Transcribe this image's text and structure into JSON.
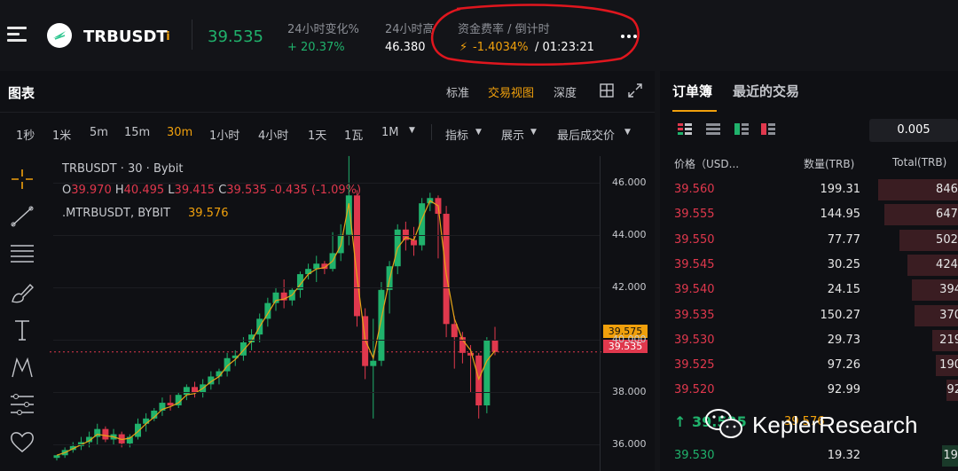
{
  "header": {
    "symbol": "TRBUSDT",
    "info_glyph": "i",
    "last_price": "39.535",
    "change_label": "24小时变化%",
    "change_value": "+ 20.37%",
    "high_label": "24小时高",
    "high_value": "46.380",
    "funding_label": "资金费率 / 倒计时",
    "funding_icon": "⚡",
    "funding_value": "-1.4034%",
    "countdown": "/ 01:23:21"
  },
  "chart_header": {
    "title": "图表",
    "views": [
      "标准",
      "交易视图",
      "深度"
    ],
    "active_view": "交易视图"
  },
  "toolbar": {
    "intervals": [
      "1秒",
      "1米",
      "5m",
      "15m",
      "30m",
      "1小时",
      "4小时",
      "1天",
      "1瓦",
      "1M"
    ],
    "active_interval": "30m",
    "indicators_label": "指标",
    "display_label": "展示",
    "last_price_label": "最后成交价"
  },
  "legend": {
    "line1": "TRBUSDT · 30 · Bybit",
    "o_label": "O",
    "o_value": "39.970",
    "h_label": "H",
    "h_value": "40.495",
    "l_label": "L",
    "l_value": "39.415",
    "c_label": "C",
    "c_value": "39.535",
    "change": "-0.435",
    "change_pct": "(-1.09%)",
    "mark_label": ".MTRBUSDT, BYBIT",
    "mark_value": "39.576"
  },
  "y_axis": {
    "ticks": [
      "46.000",
      "44.000",
      "42.000",
      "40.000",
      "38.000",
      "36.000"
    ],
    "mark_tag": "39.575",
    "last_tag": "39.535"
  },
  "chart_data": {
    "type": "candlestick",
    "ylim": [
      35.0,
      47.2
    ],
    "candles": [
      [
        35.5,
        35.6,
        35.4,
        35.6
      ],
      [
        35.6,
        35.9,
        35.5,
        35.8
      ],
      [
        35.8,
        36.1,
        35.7,
        35.95
      ],
      [
        35.95,
        36.3,
        35.8,
        36.1
      ],
      [
        36.1,
        36.5,
        35.9,
        36.3
      ],
      [
        36.3,
        36.8,
        36.0,
        36.6
      ],
      [
        36.6,
        36.7,
        36.1,
        36.2
      ],
      [
        36.2,
        36.6,
        36.0,
        36.4
      ],
      [
        36.4,
        36.5,
        35.9,
        36.05
      ],
      [
        36.05,
        36.4,
        35.9,
        36.3
      ],
      [
        36.3,
        37.0,
        36.2,
        36.8
      ],
      [
        36.8,
        37.2,
        36.5,
        37.0
      ],
      [
        37.0,
        37.4,
        36.9,
        37.3
      ],
      [
        37.3,
        37.8,
        37.1,
        37.6
      ],
      [
        37.6,
        37.9,
        37.3,
        37.5
      ],
      [
        37.5,
        38.0,
        37.4,
        37.9
      ],
      [
        37.9,
        38.3,
        37.7,
        38.2
      ],
      [
        38.2,
        38.4,
        37.8,
        38.0
      ],
      [
        38.0,
        38.5,
        37.8,
        38.3
      ],
      [
        38.3,
        38.8,
        38.1,
        38.6
      ],
      [
        38.6,
        38.9,
        38.3,
        38.8
      ],
      [
        38.8,
        39.5,
        38.6,
        39.3
      ],
      [
        39.3,
        39.6,
        39.0,
        39.4
      ],
      [
        39.4,
        40.1,
        39.2,
        39.9
      ],
      [
        39.9,
        40.4,
        39.6,
        40.2
      ],
      [
        40.2,
        41.0,
        39.9,
        40.8
      ],
      [
        40.8,
        41.6,
        40.5,
        41.4
      ],
      [
        41.4,
        42.0,
        41.1,
        41.8
      ],
      [
        41.8,
        42.3,
        41.2,
        41.5
      ],
      [
        41.5,
        42.0,
        41.3,
        41.9
      ],
      [
        41.9,
        42.6,
        41.6,
        42.5
      ],
      [
        42.5,
        42.9,
        42.3,
        42.7
      ],
      [
        42.7,
        43.2,
        42.2,
        42.9
      ],
      [
        42.9,
        43.0,
        42.5,
        42.7
      ],
      [
        42.7,
        44.1,
        42.6,
        43.3
      ],
      [
        43.3,
        44.4,
        43.0,
        44.0
      ],
      [
        44.0,
        47.0,
        43.6,
        45.5
      ],
      [
        45.5,
        45.7,
        40.5,
        40.9
      ],
      [
        40.9,
        41.2,
        38.5,
        39.0
      ],
      [
        39.0,
        40.8,
        37.0,
        39.2
      ],
      [
        39.2,
        42.2,
        39.0,
        41.9
      ],
      [
        41.9,
        43.0,
        41.0,
        42.8
      ],
      [
        42.8,
        44.4,
        42.5,
        44.2
      ],
      [
        44.2,
        44.5,
        43.4,
        43.8
      ],
      [
        43.8,
        44.3,
        43.2,
        43.6
      ],
      [
        43.6,
        45.4,
        43.4,
        45.2
      ],
      [
        45.2,
        45.6,
        44.9,
        45.4
      ],
      [
        45.4,
        45.5,
        43.1,
        44.8
      ],
      [
        44.8,
        45.1,
        40.1,
        40.6
      ],
      [
        40.6,
        40.9,
        38.9,
        40.1
      ],
      [
        40.1,
        40.3,
        39.1,
        39.5
      ],
      [
        39.5,
        39.8,
        38.0,
        39.4
      ],
      [
        39.4,
        39.5,
        37.0,
        37.5
      ],
      [
        37.5,
        40.1,
        37.2,
        39.97
      ],
      [
        39.97,
        40.49,
        39.41,
        39.535
      ]
    ],
    "ma": [
      35.6,
      35.7,
      35.85,
      36.0,
      36.15,
      36.4,
      36.35,
      36.3,
      36.2,
      36.25,
      36.5,
      36.8,
      37.05,
      37.35,
      37.45,
      37.6,
      37.9,
      37.95,
      38.15,
      38.4,
      38.6,
      39.0,
      39.25,
      39.6,
      39.95,
      40.5,
      41.0,
      41.5,
      41.55,
      41.7,
      42.1,
      42.5,
      42.7,
      42.75,
      43.0,
      43.6,
      45.2,
      42.4,
      40.0,
      39.3,
      40.8,
      42.3,
      43.5,
      43.9,
      43.8,
      44.6,
      45.3,
      45.1,
      42.5,
      40.8,
      40.0,
      39.6,
      38.5,
      39.2,
      39.58
    ]
  },
  "orderbook": {
    "tabs": [
      "订单簿",
      "最近的交易"
    ],
    "tick_size": "0.005",
    "headers": [
      "价格（USD...",
      "数量(TRB)",
      "Total(TRB)"
    ],
    "asks": [
      {
        "price": "39.560",
        "qty": "199.31",
        "total": "846.",
        "fill": 0.98
      },
      {
        "price": "39.555",
        "qty": "144.95",
        "total": "647.",
        "fill": 0.9
      },
      {
        "price": "39.550",
        "qty": "77.77",
        "total": "502.",
        "fill": 0.72
      },
      {
        "price": "39.545",
        "qty": "30.25",
        "total": "424.",
        "fill": 0.62
      },
      {
        "price": "39.540",
        "qty": "24.15",
        "total": "394",
        "fill": 0.57
      },
      {
        "price": "39.535",
        "qty": "150.27",
        "total": "370",
        "fill": 0.53
      },
      {
        "price": "39.530",
        "qty": "29.73",
        "total": "219",
        "fill": 0.31
      },
      {
        "price": "39.525",
        "qty": "97.26",
        "total": "190",
        "fill": 0.27
      },
      {
        "price": "39.520",
        "qty": "92.99",
        "total": "92",
        "fill": 0.14
      }
    ],
    "mid_price": "39.535",
    "mid_mark": "39.576",
    "bid": {
      "price": "39.530",
      "qty": "19.32",
      "total": "19."
    }
  },
  "watermark": "KeplerResearch"
}
